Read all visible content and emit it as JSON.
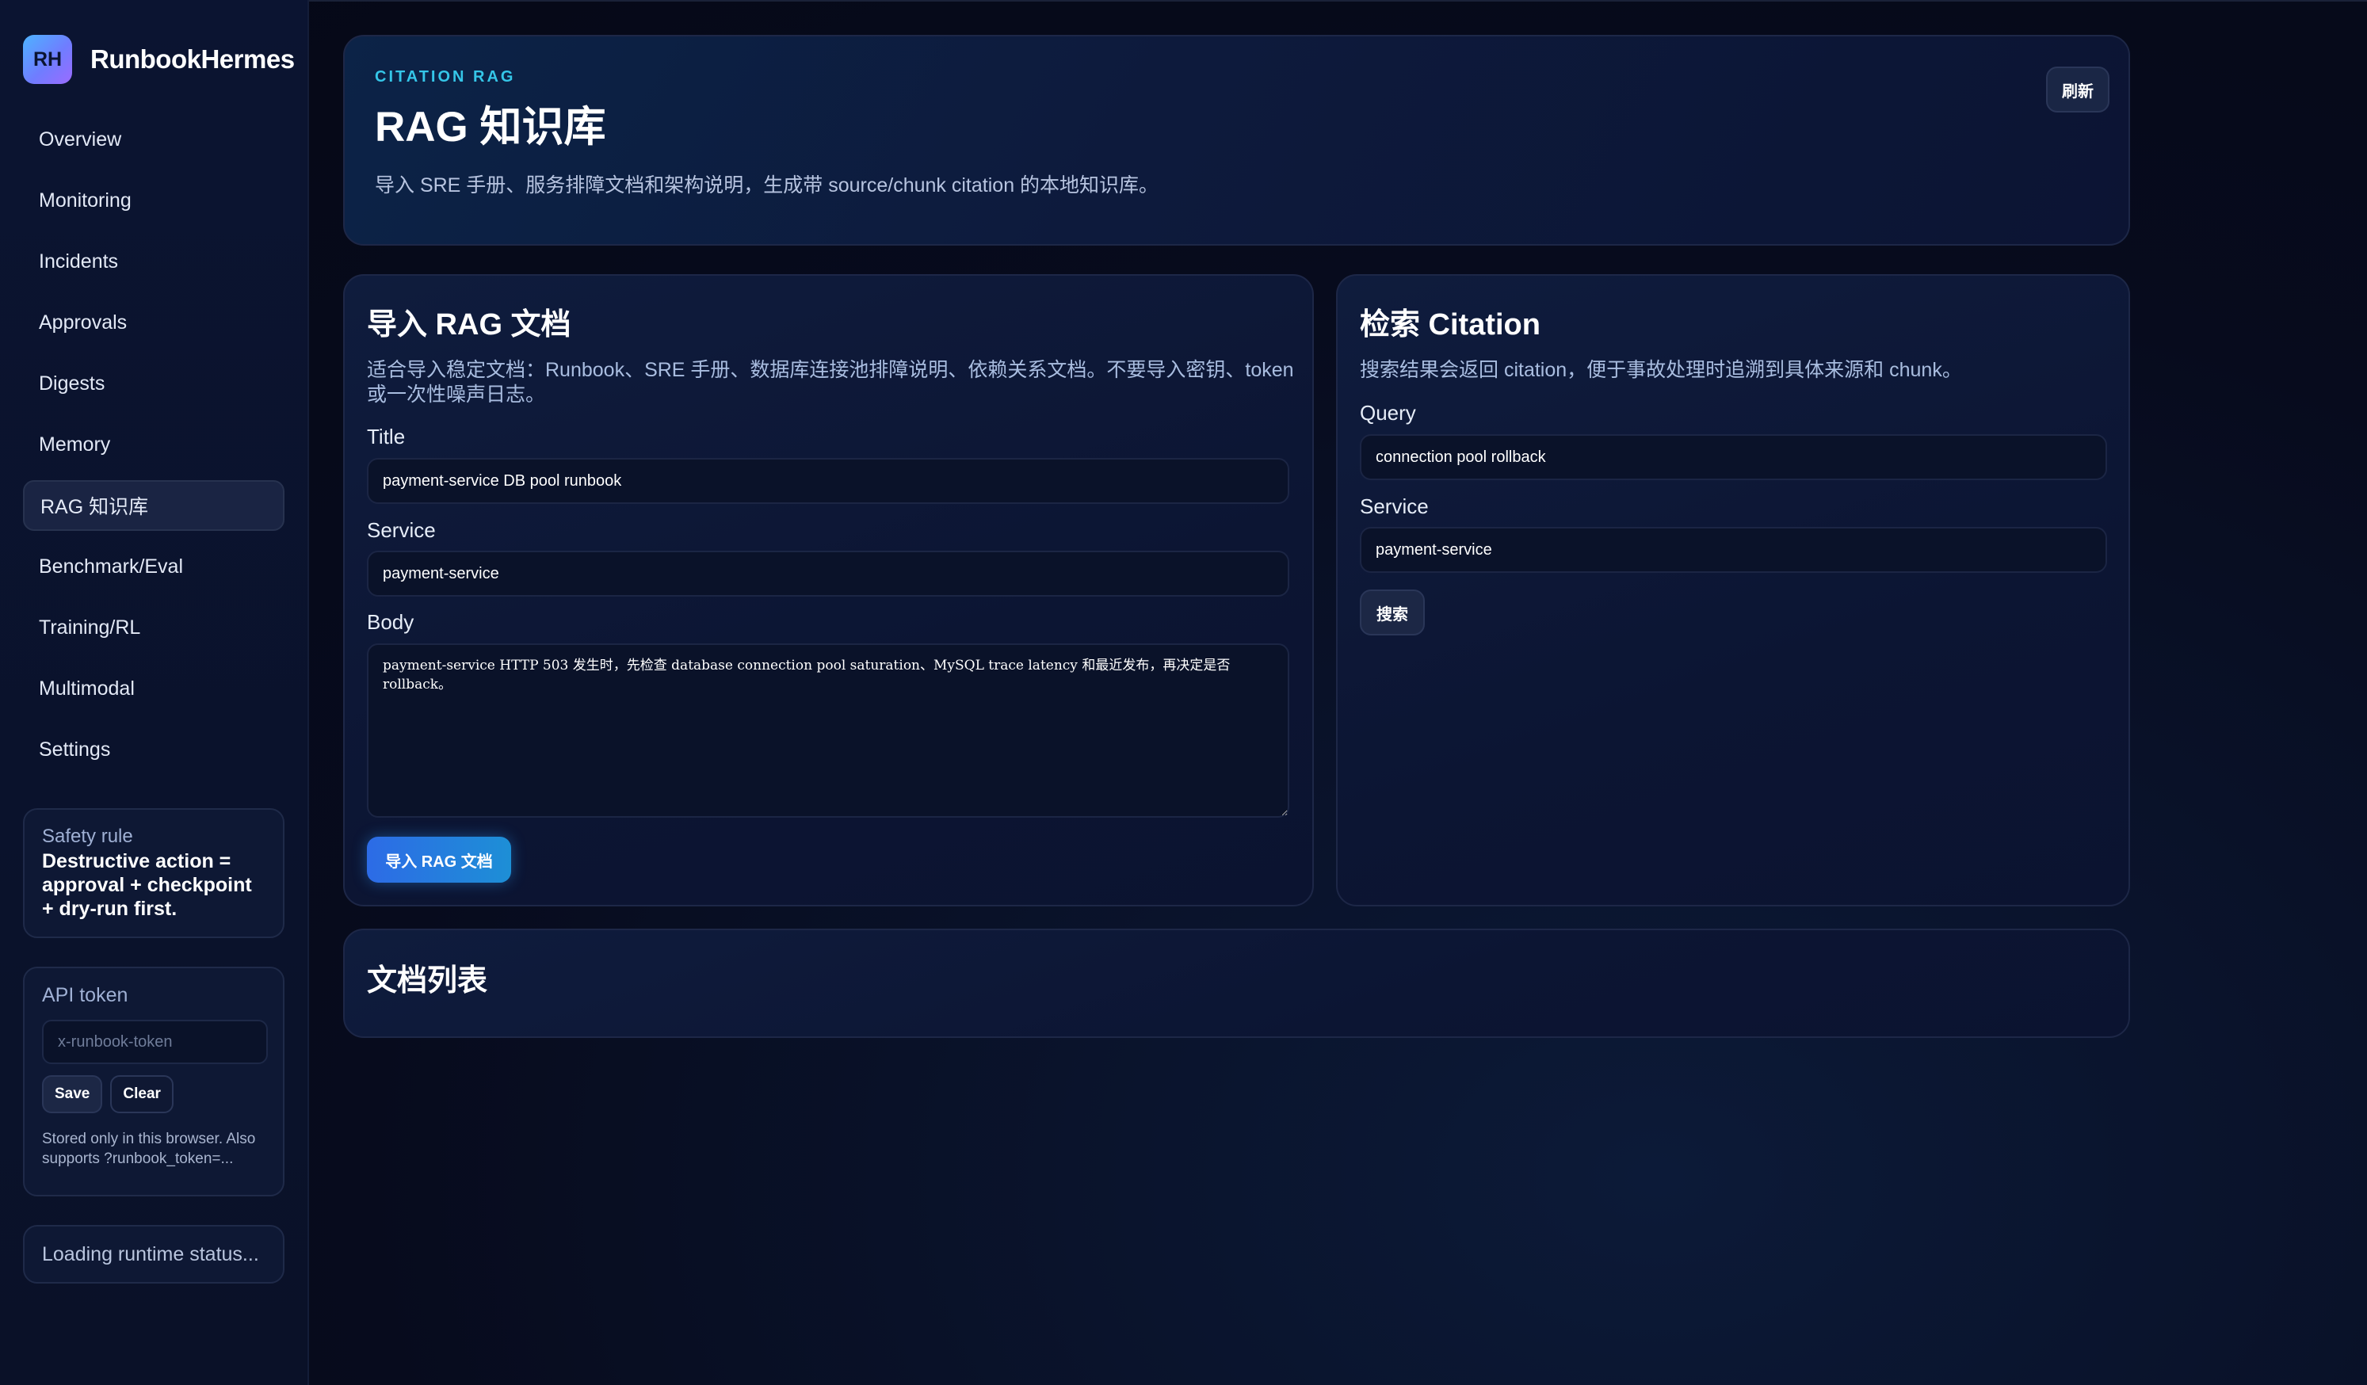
{
  "brand": {
    "logo_text": "RH",
    "name": "RunbookHermes"
  },
  "nav": {
    "items": [
      {
        "label": "Overview"
      },
      {
        "label": "Monitoring"
      },
      {
        "label": "Incidents"
      },
      {
        "label": "Approvals"
      },
      {
        "label": "Digests"
      },
      {
        "label": "Memory"
      },
      {
        "label": "RAG 知识库",
        "active": true
      },
      {
        "label": "Benchmark/Eval"
      },
      {
        "label": "Training/RL"
      },
      {
        "label": "Multimodal"
      },
      {
        "label": "Settings"
      }
    ]
  },
  "safety": {
    "label": "Safety rule",
    "text": "Destructive action = approval + checkpoint + dry-run first."
  },
  "api_token": {
    "label": "API token",
    "placeholder": "x-runbook-token",
    "value": "",
    "save_label": "Save",
    "clear_label": "Clear",
    "note": "Stored only in this browser. Also supports ?runbook_token=..."
  },
  "runtime_status": "Loading runtime status...",
  "hero": {
    "eyebrow": "CITATION RAG",
    "title": "RAG 知识库",
    "subtitle": "导入 SRE 手册、服务排障文档和架构说明，生成带 source/chunk citation 的本地知识库。",
    "refresh_label": "刷新"
  },
  "import_panel": {
    "title": "导入 RAG 文档",
    "description": "适合导入稳定文档：Runbook、SRE 手册、数据库连接池排障说明、依赖关系文档。不要导入密钥、token 或一次性噪声日志。",
    "title_label": "Title",
    "title_value": "payment-service DB pool runbook",
    "service_label": "Service",
    "service_value": "payment-service",
    "body_label": "Body",
    "body_value": "payment-service HTTP 503 发生时，先检查 database connection pool saturation、MySQL trace latency 和最近发布，再决定是否 rollback。",
    "submit_label": "导入 RAG 文档"
  },
  "search_panel": {
    "title": "检索 Citation",
    "description": "搜索结果会返回 citation，便于事故处理时追溯到具体来源和 chunk。",
    "query_label": "Query",
    "query_value": "connection pool rollback",
    "service_label": "Service",
    "service_value": "payment-service",
    "search_label": "搜索"
  },
  "list_panel": {
    "title": "文档列表"
  },
  "colors": {
    "accent": "#35c6e8",
    "primary": "#2d6be6",
    "background": "#070b1d"
  }
}
